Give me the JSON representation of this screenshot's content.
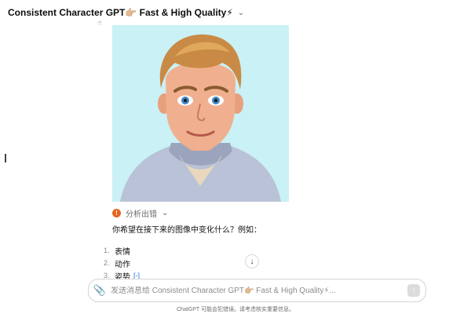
{
  "header": {
    "title": "Consistent Character GPT👉🏼 Fast & High Quality⚡",
    "chevron_icon": "chevron-down-icon"
  },
  "message": {
    "status_text": "分析出错",
    "status_icon": "alert-circle-icon",
    "question": "你希望在接下来的图像中变化什么？例如：",
    "options": [
      {
        "num": "1.",
        "label": "表情"
      },
      {
        "num": "2.",
        "label": "动作"
      },
      {
        "num": "3.",
        "label": "姿势"
      }
    ],
    "more_label": "[-]"
  },
  "composer": {
    "placeholder": "发送消息给 Consistent Character GPT👉🏼 Fast & High Quality⚡...",
    "attach_icon": "paperclip-icon",
    "send_icon": "arrow-up-icon"
  },
  "footer": {
    "disclaimer": "ChatGPT 可能会犯错误。请考虑核实重要信息。"
  },
  "colors": {
    "portrait_bg": "#c9f1f6",
    "error_icon": "#e2651f",
    "link": "#1a6fd8"
  }
}
